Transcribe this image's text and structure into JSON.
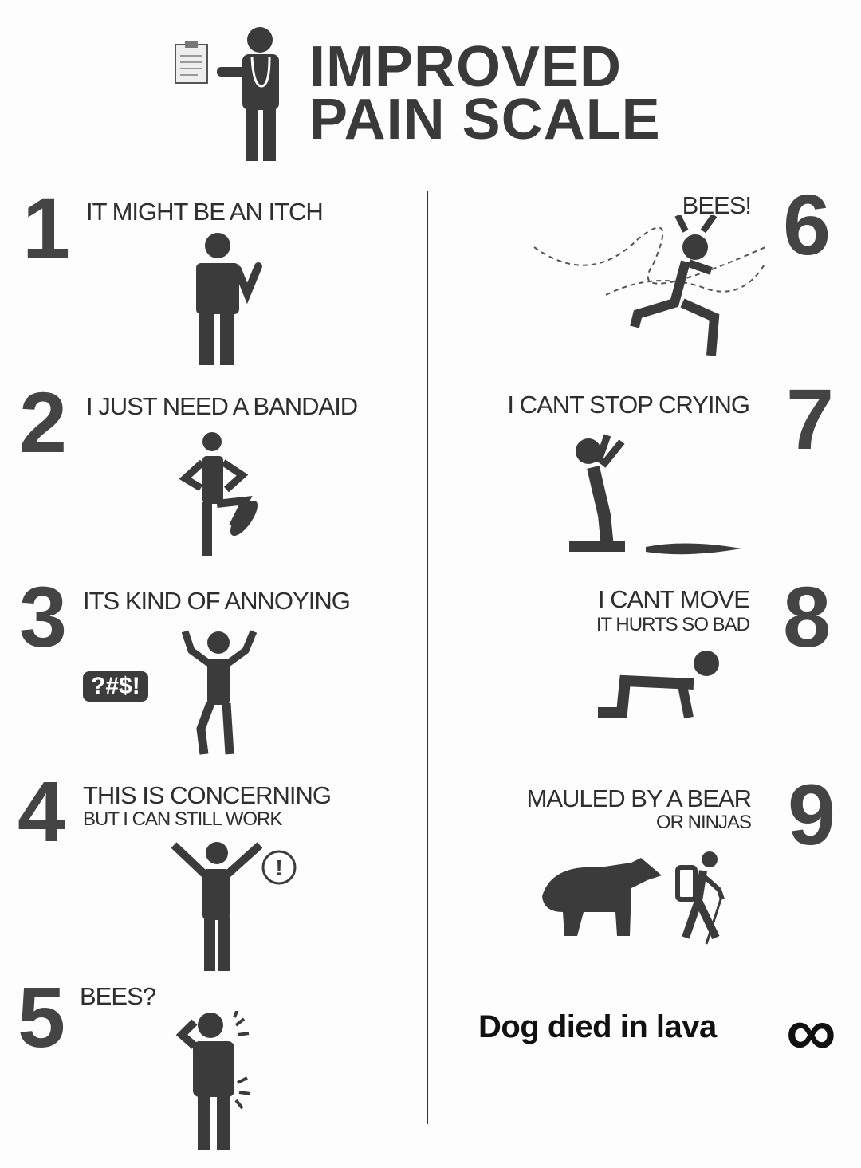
{
  "header": {
    "line1": "IMPROVED",
    "line2": "PAIN SCALE"
  },
  "levels": [
    {
      "number": "1",
      "caption": "IT MIGHT BE AN ITCH",
      "sub": ""
    },
    {
      "number": "2",
      "caption": "I JUST NEED A BANDAID",
      "sub": ""
    },
    {
      "number": "3",
      "caption": "ITS KIND OF ANNOYING",
      "sub": "",
      "bubble": "?#$!"
    },
    {
      "number": "4",
      "caption": "THIS IS CONCERNING",
      "sub": "BUT I CAN STILL WORK",
      "badge": "!"
    },
    {
      "number": "5",
      "caption": "BEES?",
      "sub": ""
    },
    {
      "number": "6",
      "caption": "BEES!",
      "sub": ""
    },
    {
      "number": "7",
      "caption": "I CANT STOP CRYING",
      "sub": ""
    },
    {
      "number": "8",
      "caption": "I CANT MOVE",
      "sub": "IT HURTS SO BAD"
    },
    {
      "number": "9",
      "caption": "MAULED BY A BEAR",
      "sub": "OR NINJAS"
    },
    {
      "number": "∞",
      "caption": "Dog died in lava",
      "sub": ""
    }
  ],
  "icons": [
    "clipboard-icon",
    "doctor-icon",
    "itch-figure-icon",
    "skateboard-figure-icon",
    "annoyed-figure-icon",
    "concerned-figure-icon",
    "bee-sting-figure-icon",
    "bees-running-figure-icon",
    "crying-figure-icon",
    "crawling-figure-icon",
    "bear-icon",
    "hiker-icon"
  ]
}
